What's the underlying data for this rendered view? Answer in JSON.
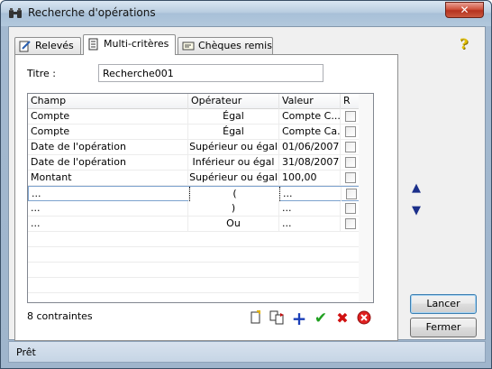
{
  "window": {
    "title": "Recherche d'opérations",
    "close_label": "✕"
  },
  "tabs": [
    {
      "label": "Relevés",
      "icon": "pencil-doc-icon"
    },
    {
      "label": "Multi-critères",
      "icon": "document-icon"
    },
    {
      "label": "Chèques remis",
      "icon": "cheque-icon"
    }
  ],
  "form": {
    "titre_label": "Titre :",
    "titre_value": "Recherche001"
  },
  "grid": {
    "columns": [
      "Champ",
      "Opérateur",
      "Valeur",
      "R"
    ],
    "rows": [
      {
        "champ": "Compte",
        "operateur": "Égal",
        "valeur": "Compte C...",
        "r": false
      },
      {
        "champ": "Compte",
        "operateur": "Égal",
        "valeur": "Compte Ca...",
        "r": false
      },
      {
        "champ": "Date de l'opération",
        "operateur": "Supérieur ou égal",
        "valeur": "01/06/2007",
        "r": false
      },
      {
        "champ": "Date de l'opération",
        "operateur": "Inférieur ou égal",
        "valeur": "31/08/2007",
        "r": false
      },
      {
        "champ": "Montant",
        "operateur": "Supérieur ou égal",
        "valeur": "100,00",
        "r": false
      },
      {
        "champ": "...",
        "operateur": "(",
        "valeur": "...",
        "r": false
      },
      {
        "champ": "...",
        "operateur": ")",
        "valeur": "...",
        "r": false
      },
      {
        "champ": "...",
        "operateur": "Ou",
        "valeur": "...",
        "r": false
      }
    ],
    "selected_row": 5
  },
  "footer": {
    "count_text": "8 contraintes"
  },
  "buttons": {
    "lancer": "Lancer",
    "fermer": "Fermer"
  },
  "status": {
    "text": "Prêt"
  },
  "colors": {
    "accent_blue": "#1b2f8a",
    "check_green": "#20a020",
    "cross_red": "#d01010"
  }
}
